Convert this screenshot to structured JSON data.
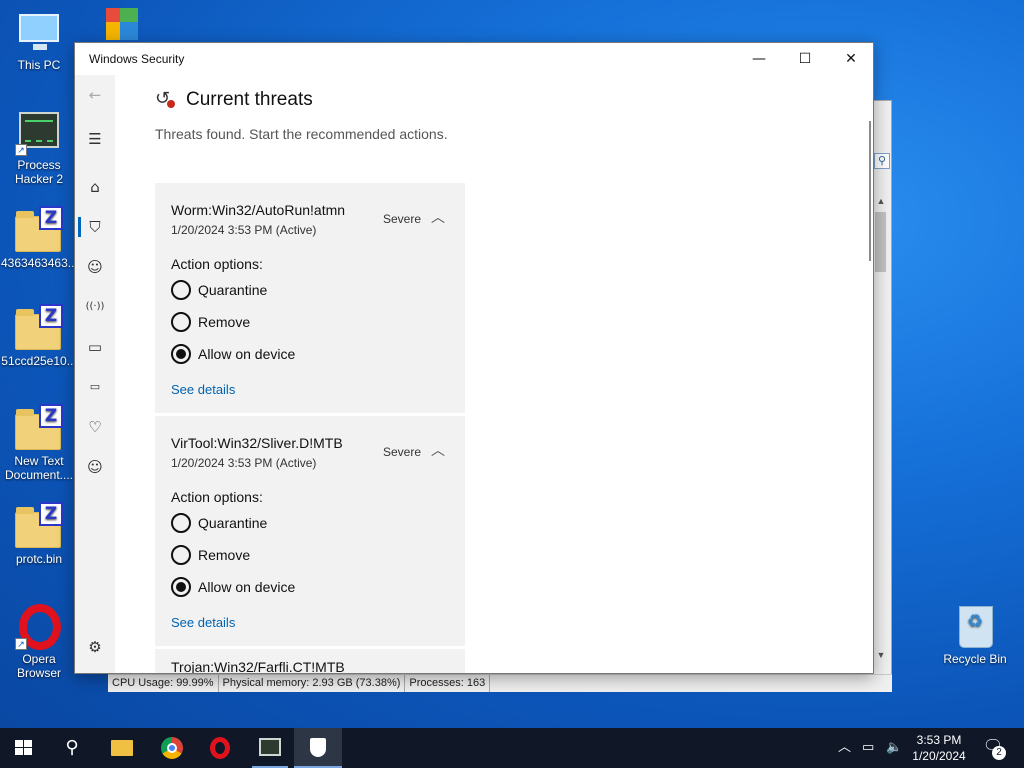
{
  "desktop": {
    "icons": [
      {
        "label": "This PC",
        "icon": "this-pc-icon"
      },
      {
        "label": "Process Hacker 2",
        "icon": "process-hacker-icon"
      },
      {
        "label": "4363463463...",
        "icon": "zip-folder-icon"
      },
      {
        "label": "51ccd25e10...",
        "icon": "zip-folder-icon"
      },
      {
        "label": "New Text Document....",
        "icon": "zip-folder-icon"
      },
      {
        "label": "protc.bin",
        "icon": "zip-folder-icon"
      },
      {
        "label": "Opera Browser",
        "icon": "opera-icon"
      },
      {
        "label": "Recycle Bin",
        "icon": "recycle-bin-icon"
      }
    ],
    "zip_badge": "Z"
  },
  "background_window": {
    "status": {
      "cpu": "CPU Usage: 99.99%",
      "memory": "Physical memory: 2.93 GB (73.38%)",
      "processes": "Processes: 163"
    }
  },
  "window": {
    "title": "Windows Security",
    "controls": {
      "minimize": "—",
      "maximize": "☐",
      "close": "✕"
    },
    "nav": {
      "back": "←",
      "menu": "☰",
      "home": "⌂",
      "shield": "⛉",
      "account": "☺",
      "network": "((·))",
      "app": "▭",
      "device": "▭",
      "health": "♡",
      "family": "☺",
      "settings": "⚙"
    },
    "page": {
      "heading": "Current threats",
      "subtitle": "Threats found. Start the recommended actions."
    },
    "threats": [
      {
        "name": "Worm:Win32/AutoRun!atmn",
        "date": "1/20/2024 3:53 PM (Active)",
        "severity": "Severe",
        "action_label": "Action options:",
        "options": [
          "Quarantine",
          "Remove",
          "Allow on device"
        ],
        "selected": "Allow on device",
        "details_link": "See details"
      },
      {
        "name": "VirTool:Win32/Sliver.D!MTB",
        "date": "1/20/2024 3:53 PM (Active)",
        "severity": "Severe",
        "action_label": "Action options:",
        "options": [
          "Quarantine",
          "Remove",
          "Allow on device"
        ],
        "selected": "Allow on device",
        "details_link": "See details"
      }
    ],
    "third_threat_partial": "Trojan:Win32/Farfli.CT!MTB"
  },
  "taskbar": {
    "apps": [
      "start-icon",
      "search-icon",
      "file-explorer-icon",
      "chrome-icon",
      "opera-icon",
      "process-hacker-icon",
      "windows-security-icon"
    ],
    "time": "3:53 PM",
    "date": "1/20/2024",
    "notifications": "2"
  },
  "colors": {
    "accent": "#0067c0",
    "link": "#0063b1",
    "taskbar": "#101828",
    "card": "#f2f2f2"
  }
}
